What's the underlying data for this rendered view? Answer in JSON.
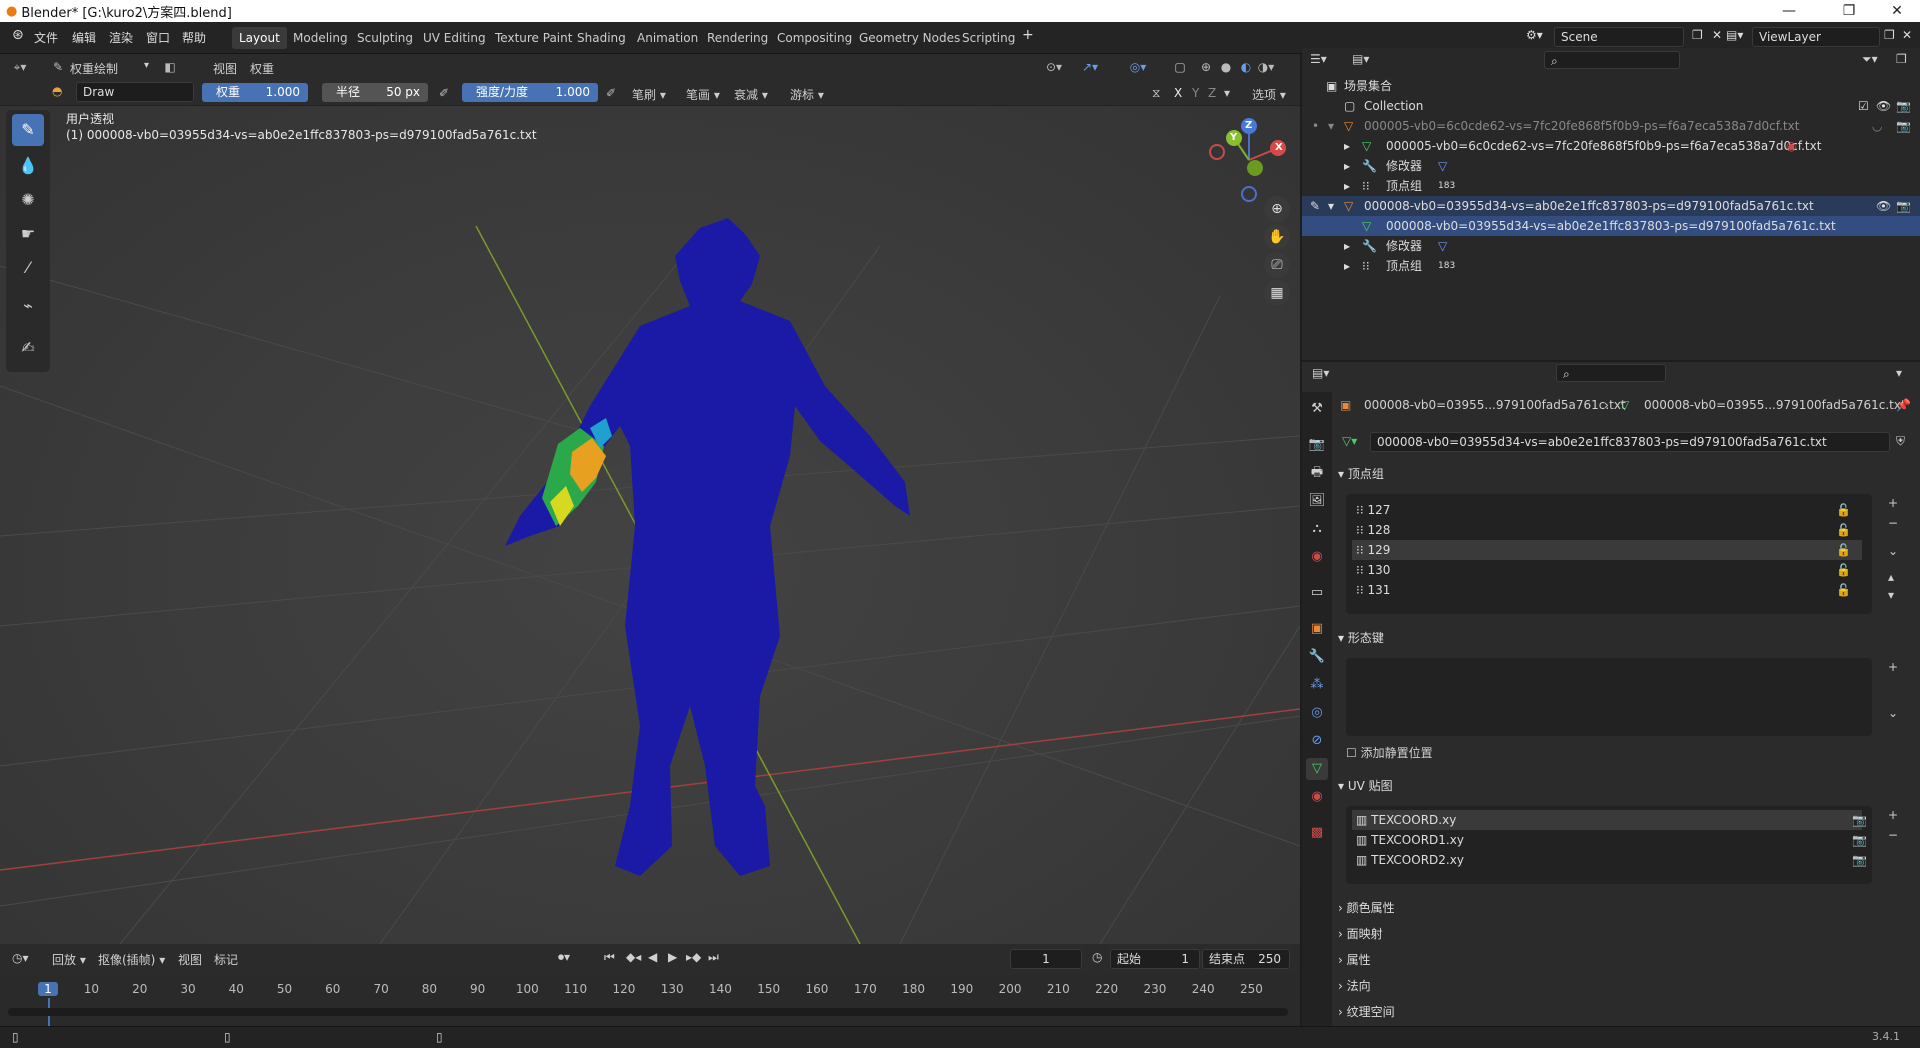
{
  "window": {
    "title": "Blender* [G:\\kuro2\\方案四.blend]",
    "minimize": "—",
    "maximize": "❐",
    "close": "✕"
  },
  "menu": {
    "items": [
      "文件",
      "编辑",
      "渲染",
      "窗口",
      "帮助"
    ]
  },
  "workspaces": [
    "Layout",
    "Modeling",
    "Sculpting",
    "UV Editing",
    "Texture Paint",
    "Shading",
    "Animation",
    "Rendering",
    "Compositing",
    "Geometry Nodes",
    "Scripting"
  ],
  "active_workspace": "Layout",
  "scene": {
    "name": "Scene",
    "view_layer": "ViewLayer"
  },
  "viewport_header": {
    "mode": "权重绘制",
    "menus": [
      "视图",
      "权重"
    ]
  },
  "tool_header": {
    "brush": "Draw",
    "weight_label": "权重",
    "weight_value": "1.000",
    "radius_label": "半径",
    "radius_value": "50 px",
    "strength_label": "强度/力度",
    "strength_value": "1.000",
    "menus": [
      "笔刷",
      "笔画",
      "衰减",
      "游标"
    ],
    "axes": [
      "X",
      "Y",
      "Z"
    ],
    "options": "选项"
  },
  "viewport": {
    "view_name": "用户透视",
    "object_info": "(1) 000008-vb0=03955d34-vs=ab0e2e1ffc837803-ps=d979100fad5a761c.txt"
  },
  "gizmo": {
    "x": "X",
    "y": "Y",
    "z": "Z"
  },
  "outliner": {
    "scene_collection": "场景集合",
    "collection": "Collection",
    "rows": [
      {
        "label": "000005-vb0=6c0cde62-vs=7fc20fe868f5f0b9-ps=f6a7eca538a7d0cf.txt"
      },
      {
        "label": "000005-vb0=6c0cde62-vs=7fc20fe868f5f0b9-ps=f6a7eca538a7d0cf.txt"
      },
      {
        "label": "修改器"
      },
      {
        "label": "顶点组"
      },
      {
        "label": "000008-vb0=03955d34-vs=ab0e2e1ffc837803-ps=d979100fad5a761c.txt"
      },
      {
        "label": "000008-vb0=03955d34-vs=ab0e2e1ffc837803-ps=d979100fad5a761c.txt"
      },
      {
        "label": "修改器"
      },
      {
        "label": "顶点组"
      }
    ],
    "badge_183": "183"
  },
  "properties": {
    "breadcrumb_obj": "000008-vb0=03955...979100fad5a761c.txt",
    "breadcrumb_data": "000008-vb0=03955...979100fad5a761c.txt",
    "mesh_name": "000008-vb0=03955d34-vs=ab0e2e1ffc837803-ps=d979100fad5a761c.txt",
    "vertex_groups_title": "顶点组",
    "vertex_groups": [
      "127",
      "128",
      "129",
      "130",
      "131"
    ],
    "active_vertex_group": "129",
    "shape_keys_title": "形态键",
    "add_rest_position": "添加静置位置",
    "uv_maps_title": "UV 贴图",
    "uv_maps": [
      "TEXCOORD.xy",
      "TEXCOORD1.xy",
      "TEXCOORD2.xy"
    ],
    "collapsed_sections": [
      "颜色属性",
      "面映射",
      "属性",
      "法向",
      "纹理空间"
    ]
  },
  "timeline": {
    "menus": [
      "回放",
      "抠像(插帧)",
      "视图",
      "标记"
    ],
    "current_frame": "1",
    "start_label": "起始",
    "start_value": "1",
    "end_label": "结束点",
    "end_value": "250",
    "ticks": [
      "1",
      "10",
      "20",
      "30",
      "40",
      "50",
      "60",
      "70",
      "80",
      "90",
      "100",
      "110",
      "120",
      "130",
      "140",
      "150",
      "160",
      "170",
      "180",
      "190",
      "200",
      "210",
      "220",
      "230",
      "240",
      "250"
    ]
  },
  "status": {
    "version": "3.4.1"
  }
}
